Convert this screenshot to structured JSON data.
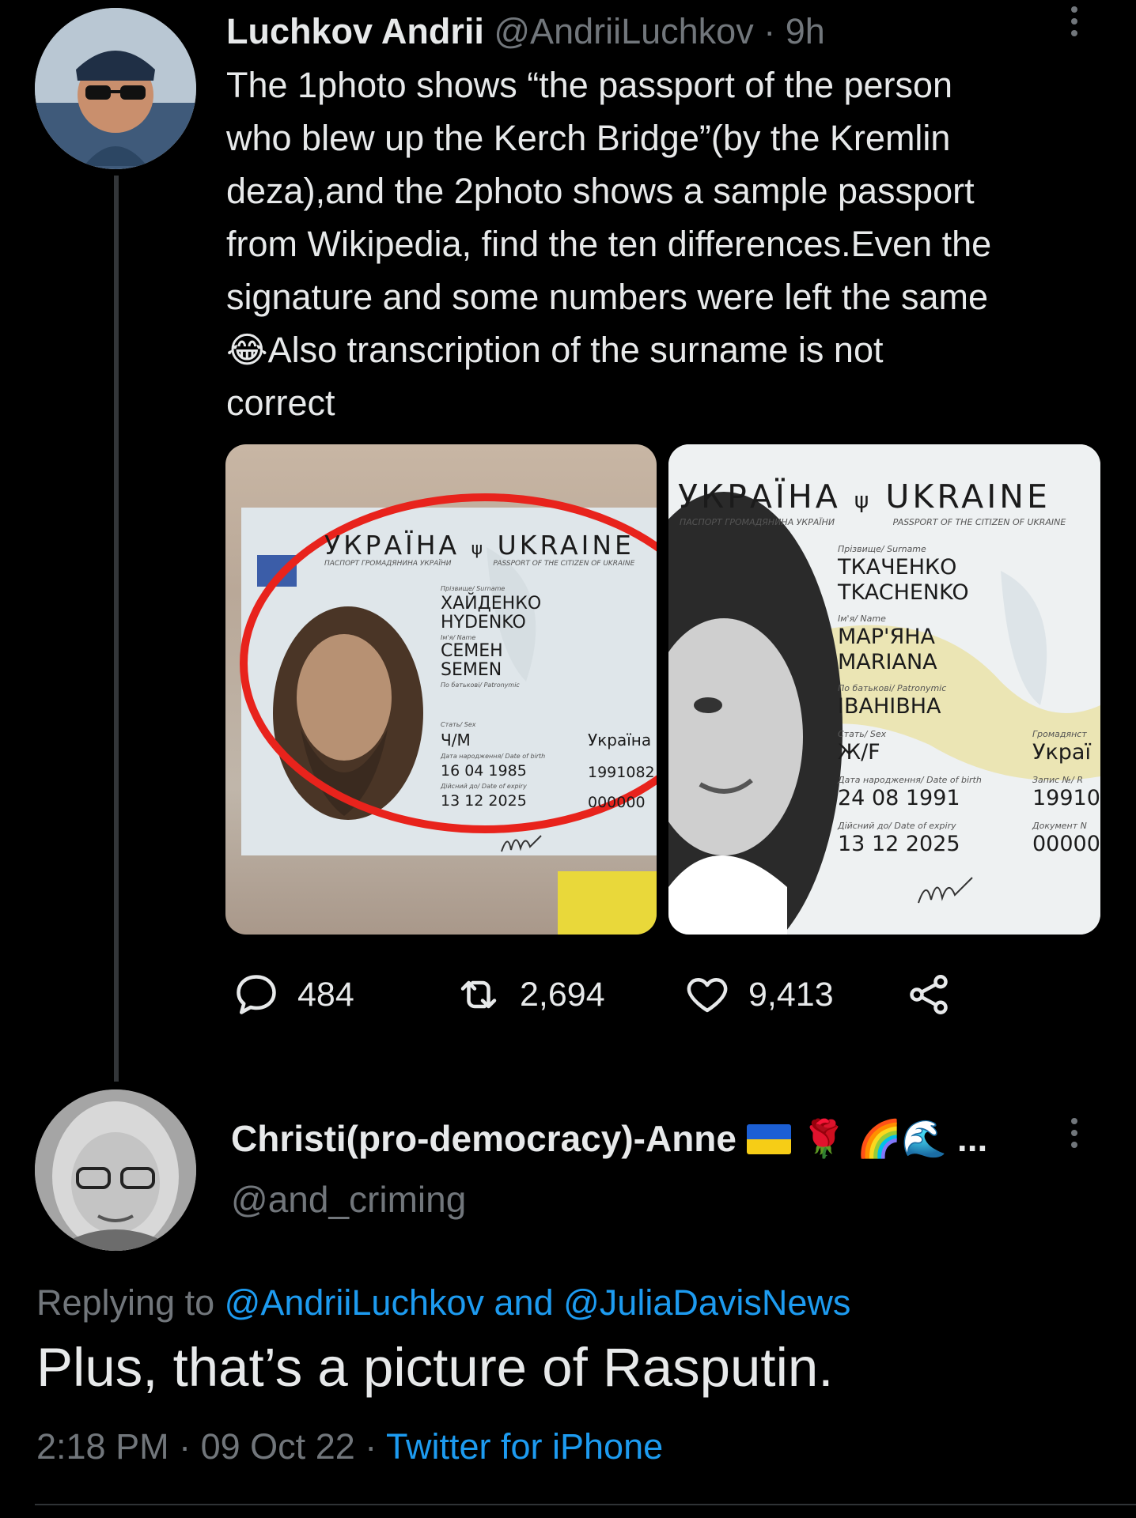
{
  "tweet": {
    "author_name": "Luchkov Andrii",
    "handle": "@AndriiLuchkov",
    "age": "· 9h",
    "text_lines": [
      "The 1photo shows “the passport of the person",
      "who blew up the Kerch Bridge”(by the Kremlin",
      "deza),and the 2photo shows a sample passport",
      "from Wikipedia, find the ten differences.Even the",
      "signature and some numbers were left the same",
      "Also transcription of the surname is not",
      "correct"
    ],
    "emoji": "😂",
    "stats": {
      "replies": "484",
      "retweets": "2,694",
      "likes": "9,413"
    }
  },
  "photo1": {
    "header_ua": "УКРАЇНА",
    "header_en": "UKRAINE",
    "subheader_ua": "ПАСПОРТ ГРОМАДЯНИНА УКРАЇНИ",
    "subheader_en": "PASSPORT OF THE CITIZEN OF UKRAINE",
    "surname_label": "Прізвище/ Surname",
    "surname_ua": "ХАЙДЕНКО",
    "surname_en": "HYDENKO",
    "name_label": "Ім'я/ Name",
    "name_ua": "СЕМЕН",
    "name_en": "SEMEN",
    "patronymic_label": "По батькові/ Patronymic",
    "sex_label": "Стать/ Sex",
    "sex": "Ч/М",
    "citizenship": "Україна",
    "dob_label": "Дата народження/ Date of birth",
    "dob": "16 04 1985",
    "record": "1991082",
    "expiry_label": "Дійсний до/ Date of expiry",
    "expiry": "13 12 2025",
    "doc_no": "000000"
  },
  "photo2": {
    "header_ua": "УКРАЇНА",
    "header_en": "UKRAINE",
    "subheader_ua": "ПАСПОРТ ГРОМАДЯНИНА УКРАЇНИ",
    "subheader_en": "PASSPORT OF THE CITIZEN OF UKRAINE",
    "surname_label": "Прізвище/ Surname",
    "surname_ua": "ТКАЧЕНКО",
    "surname_en": "TKACHENKO",
    "name_label": "Ім'я/ Name",
    "name_ua": "МАР'ЯНА",
    "name_en": "MARIANA",
    "patronymic_label": "По батькові/ Patronymic",
    "patronymic": "ІВАНІВНА",
    "sex_label": "Стать/ Sex",
    "sex": "Ж/F",
    "dob_label": "Дата народження/ Date of birth",
    "dob": "24 08 1991",
    "expiry_label": "Дійсний до/ Date of expiry",
    "expiry": "13 12 2025",
    "citizenship_label": "Громадянст",
    "citizenship": "Украї",
    "record_label": "Запис №/ R",
    "record": "19910",
    "doc_label": "Документ N",
    "doc_no": "00000"
  },
  "reply": {
    "author_name": "Christi(pro-democracy)-Anne",
    "name_emoji": "🌹 🌈🌊",
    "ellipsis": "...",
    "handle": "@and_criming",
    "replying_prefix": "Replying to",
    "replying_user1": "@AndriiLuchkov",
    "replying_and": "and",
    "replying_user2": "@JuliaDavisNews",
    "text": "Plus, that’s a picture of Rasputin.",
    "time": "2:18 PM",
    "date": "09 Oct 22",
    "source": "Twitter for iPhone"
  },
  "colors": {
    "link": "#1d9bf0",
    "muted": "#71767b",
    "text": "#e7e9ea",
    "highlight_circle": "#e8231c"
  },
  "icons": [
    "avatar",
    "more-icon",
    "reply-icon",
    "retweet-icon",
    "like-icon",
    "share-icon",
    "ukraine-flag-icon"
  ]
}
